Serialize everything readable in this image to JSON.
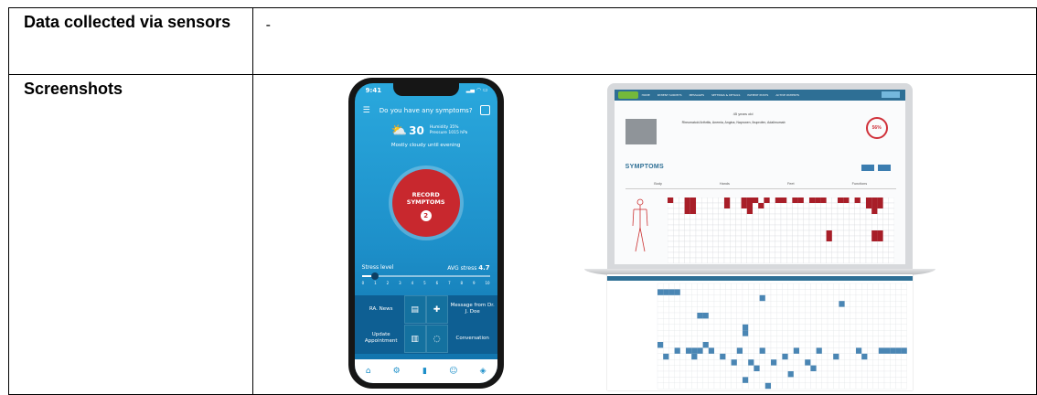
{
  "table": {
    "rows": [
      {
        "label": "Data collected via sensors",
        "value": "-"
      },
      {
        "label": "Screenshots",
        "value": ""
      }
    ]
  },
  "phone": {
    "time": "9:41",
    "question": "Do you have any symptoms?",
    "temperature": "30",
    "humidity": "Humidity 35%",
    "pressure": "Pressure 1015 hPa",
    "forecast": "Mostly cloudy until evening",
    "record_line1": "RECORD",
    "record_line2": "SYMPTOMS",
    "record_count": "2",
    "stress_label": "Stress level",
    "avg_stress_label": "AVG stress",
    "avg_stress_value": "4.7",
    "stress_level": 1,
    "stress_max": 10,
    "ticks": [
      "0",
      "1",
      "2",
      "3",
      "4",
      "5",
      "6",
      "7",
      "8",
      "9",
      "10"
    ],
    "tiles": {
      "ra_news": "RA. News",
      "message": "Message from Dr. J. Doe",
      "update": "Update Appointment",
      "conversation": "Conversation"
    }
  },
  "laptop": {
    "nav_items": [
      "HOME",
      "PATIENT SURVEYS",
      "MESSAGES",
      "SETTINGS & DETAILS",
      "PATIENT POSTS",
      "ACTIVE PATIENTS"
    ],
    "age": "45 years old",
    "diagnoses": "Rheumatoid Arthritis, Anemia, Angina, Naproxen, Ibuprofen, Adalimumab",
    "score": "56%",
    "symptoms_title": "SYMPTOMS",
    "tabs": [
      "Body",
      "Hands",
      "Feet",
      "Functions"
    ]
  },
  "colors": {
    "phone_bg": "#1d8fc9",
    "record_red": "#c8282e",
    "grid_red": "#a81e28",
    "grid_blue": "#4a86b4"
  },
  "icons": [
    "menu-icon",
    "calendar-icon",
    "cloud-sun-icon",
    "news-icon",
    "plus-icon",
    "clipboard-icon",
    "chat-icon",
    "home-icon",
    "gear-icon",
    "chart-icon",
    "people-icon",
    "pill-icon"
  ]
}
